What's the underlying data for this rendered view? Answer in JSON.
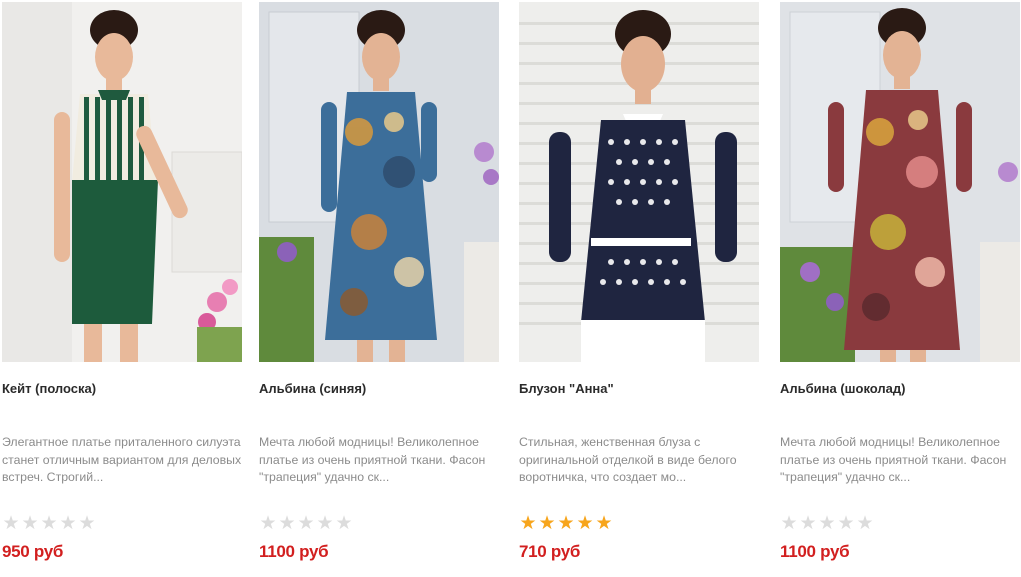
{
  "colors": {
    "price": "#d21f1f",
    "star_on": "#f7a51c",
    "star_off": "#dcdcdc",
    "title": "#2b2b2b",
    "description": "#8b8b8b"
  },
  "products": [
    {
      "name": "Кейт (полоска)",
      "description": "Элегантное платье приталенного силуэта станет отличным вариантом для деловых встреч. Строгий...",
      "rating": 0,
      "price": "950",
      "currency": "руб"
    },
    {
      "name": "Альбина (синяя)",
      "description": "Мечта любой модницы! Великолепное платье из очень приятной ткани. Фасон \"трапеция\" удачно ск...",
      "rating": 0,
      "price": "1100",
      "currency": "руб"
    },
    {
      "name": "Блузон \"Анна\"",
      "description": "Стильная, женственная блуза с оригинальной отделкой в виде белого воротничка, что создает мо...",
      "rating": 5,
      "price": "710",
      "currency": "руб"
    },
    {
      "name": "Альбина (шоколад)",
      "description": "Мечта любой модницы! Великолепное платье из очень приятной ткани. Фасон \"трапеция\" удачно ск...",
      "rating": 0,
      "price": "1100",
      "currency": "руб"
    }
  ]
}
